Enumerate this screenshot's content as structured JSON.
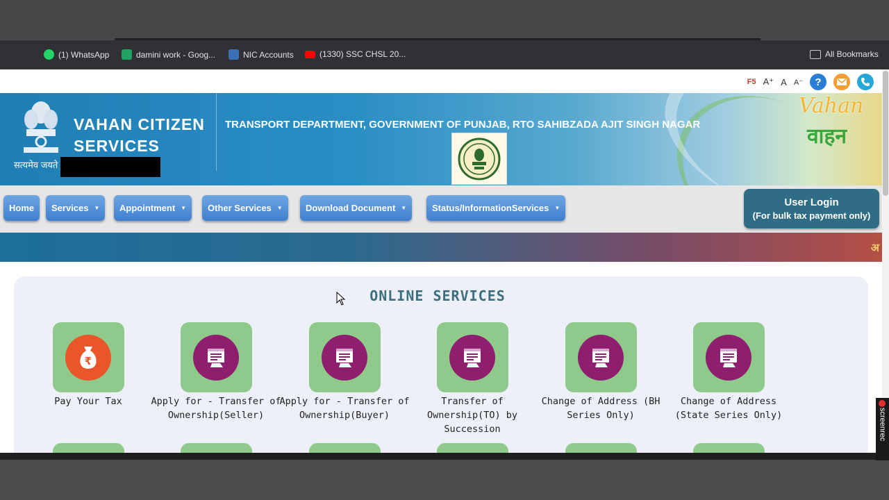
{
  "browser": {
    "bookmarks": [
      {
        "label": "(1) WhatsApp",
        "color": "#25d366"
      },
      {
        "label": "damini work - Goog...",
        "color": "#1fa463"
      },
      {
        "label": "NIC Accounts",
        "color": "#3b6fb6"
      },
      {
        "label": "(1330) SSC CHSL 20...",
        "color": "#ff0000"
      }
    ],
    "all_bookmarks": "All Bookmarks"
  },
  "utility": {
    "f5": "F5",
    "font_up": "A⁺",
    "font_normal": "A",
    "font_down": "A⁻",
    "help_icon": "?",
    "colors": {
      "help": "#2a7ed8",
      "mail": "#f39c32",
      "phone": "#26a7d8"
    }
  },
  "header": {
    "brand_line1": "VAHAN CITIZEN",
    "brand_line2": "SERVICES",
    "motto": "सत्यमेव जयते",
    "department": "TRANSPORT DEPARTMENT, GOVERNMENT OF PUNJAB, RTO SAHIBZADA AJIT SINGH NAGAR",
    "logo_line1": "Vahan",
    "logo_line2": "वाहन"
  },
  "nav": {
    "home": "Home",
    "services": "Services",
    "appointment": "Appointment",
    "other_services": "Other Services",
    "download_document": "Download Document",
    "status_info": "Status/InformationServices",
    "user_login_line1": "User Login",
    "user_login_line2": "(For bulk tax payment only)"
  },
  "ticker": {
    "glyph": "अ"
  },
  "services": {
    "title": "ONLINE SERVICES",
    "tiles": [
      {
        "label_1": "Pay Your Tax",
        "label_2": "",
        "label_3": "",
        "icon": "money-bag-icon",
        "color": "#e8562a"
      },
      {
        "label_1": "Apply for - Transfer of",
        "label_2": "Ownership(Seller)",
        "label_3": "",
        "icon": "form-hand-icon",
        "color": "#8e1e6e"
      },
      {
        "label_1": "Apply for - Transfer of",
        "label_2": "Ownership(Buyer)",
        "label_3": "",
        "icon": "form-hand-icon",
        "color": "#8e1e6e"
      },
      {
        "label_1": "Transfer of",
        "label_2": "Ownership(TO) by",
        "label_3": "Succession",
        "icon": "form-hand-icon",
        "color": "#8e1e6e"
      },
      {
        "label_1": "Change of Address (BH",
        "label_2": "Series Only)",
        "label_3": "",
        "icon": "form-hand-icon",
        "color": "#8e1e6e"
      },
      {
        "label_1": "Change of Address",
        "label_2": "(State Series Only)",
        "label_3": "",
        "icon": "form-hand-icon",
        "color": "#8e1e6e"
      }
    ]
  },
  "recorder": {
    "label": "screenrec"
  }
}
